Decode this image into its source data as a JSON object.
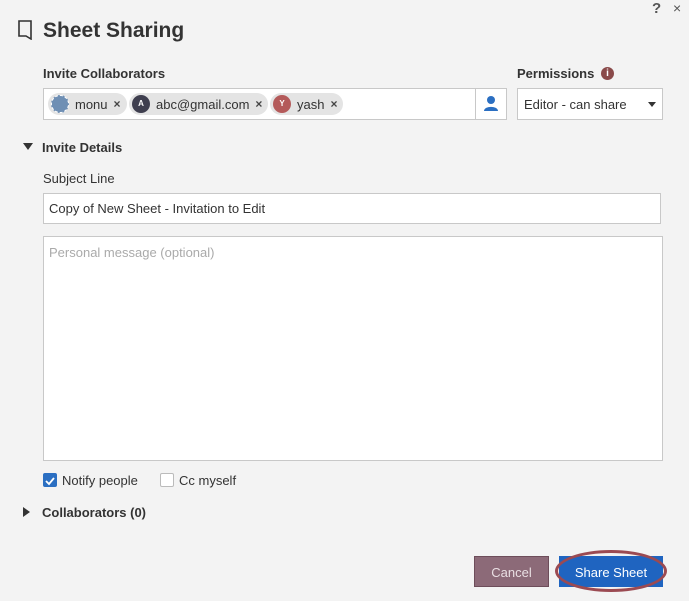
{
  "header": {
    "title": "Sheet Sharing",
    "help_glyph": "?",
    "close_glyph": "×"
  },
  "invite": {
    "label": "Invite Collaborators",
    "chips": [
      {
        "name": "monu",
        "avatar_letter": "",
        "avatar_color": "#6f8fb4"
      },
      {
        "name": "abc@gmail.com",
        "avatar_letter": "A",
        "avatar_color": "#3f3f4f"
      },
      {
        "name": "yash",
        "avatar_letter": "Y",
        "avatar_color": "#b45a5a"
      }
    ],
    "remove_glyph": "×",
    "contacts_icon": "person-icon"
  },
  "permissions": {
    "label": "Permissions",
    "info_glyph": "i",
    "selected": "Editor - can share"
  },
  "details": {
    "label": "Invite Details",
    "subject_label": "Subject Line",
    "subject_value": "Copy of New Sheet - Invitation to Edit",
    "message_placeholder": "Personal message (optional)"
  },
  "options": {
    "notify_label": "Notify people",
    "notify_checked": true,
    "cc_label": "Cc myself",
    "cc_checked": false
  },
  "collaborators": {
    "label": "Collaborators (0)"
  },
  "buttons": {
    "cancel": "Cancel",
    "share": "Share Sheet"
  },
  "colors": {
    "accent": "#1f64c0",
    "cancel_bg": "#8c6a78",
    "highlight_ring": "#9b4a52"
  }
}
